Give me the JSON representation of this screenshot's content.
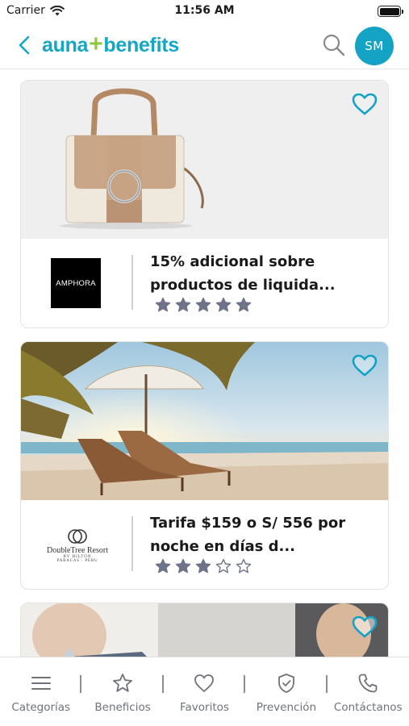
{
  "status_bar": {
    "carrier": "Carrier",
    "time": "11:56 AM"
  },
  "header": {
    "logo_part1": "auna",
    "logo_plus": "+",
    "logo_part2": "benefits",
    "avatar_initials": "SM"
  },
  "cards": [
    {
      "brand": "AMPHORA",
      "title": "15% adicional sobre productos de liquida...",
      "rating": 5,
      "max_rating": 5,
      "favorite": false
    },
    {
      "brand": "DOUBLETREE RESORT",
      "brand_line1": "DoubleTree Resort",
      "brand_line2": "BY HILTON",
      "brand_line3": "PARACAS · PERU",
      "title": "Tarifa $159 o S/ 556 por noche en días d...",
      "rating": 3,
      "max_rating": 5,
      "favorite": false
    },
    {
      "favorite": false
    }
  ],
  "tabs": [
    {
      "label": "Categorías",
      "icon": "menu-icon"
    },
    {
      "label": "Beneficios",
      "icon": "star-icon"
    },
    {
      "label": "Favoritos",
      "icon": "heart-icon"
    },
    {
      "label": "Prevención",
      "icon": "shield-check-icon"
    },
    {
      "label": "Contáctanos",
      "icon": "phone-icon"
    }
  ],
  "colors": {
    "brand_teal": "#13a7c4",
    "brand_green": "#93c83e",
    "star_filled": "#6f7389",
    "tab_gray": "#6f7279"
  }
}
